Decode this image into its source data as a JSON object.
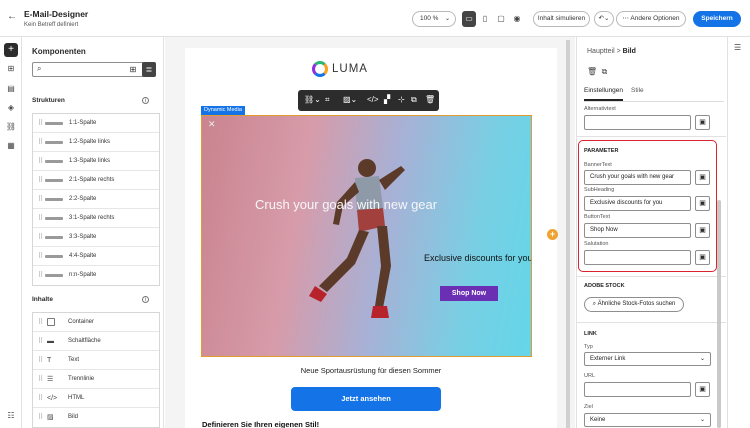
{
  "header": {
    "back_icon": "arrow-left-icon",
    "title": "E-Mail-Designer",
    "subtitle": "Kein Betreff definiert",
    "zoom": "100 %",
    "preview_label": "Inhalt simulieren",
    "more_label": "Andere Optionen",
    "save_label": "Speichern"
  },
  "components": {
    "title": "Komponenten",
    "search_placeholder": "",
    "structures_title": "Strukturen",
    "structures": [
      "1:1-Spalte",
      "1:2-Spalte links",
      "1:3-Spalte links",
      "2:1-Spalte rechts",
      "2:2-Spalte",
      "3:1-Spalte rechts",
      "3:3-Spalte",
      "4:4-Spalte",
      "n:n-Spalte"
    ],
    "content_title": "Inhalte",
    "contents": [
      {
        "label": "Container",
        "icon": "container-icon"
      },
      {
        "label": "Schaltfläche",
        "icon": "button-icon"
      },
      {
        "label": "Text",
        "icon": "text-icon"
      },
      {
        "label": "Trennlinie",
        "icon": "divider-icon"
      },
      {
        "label": "HTML",
        "icon": "code-icon"
      },
      {
        "label": "Bild",
        "icon": "image-icon"
      }
    ]
  },
  "email": {
    "logo_text": "LUMA",
    "dynamic_media_tag": "Dynamic Media",
    "banner_heading": "Crush your goals with new gear",
    "banner_subheading": "Exclusive discounts for you",
    "banner_cta": "Shop Now",
    "subline": "Neue Sportausrüstung für diesen Sommer",
    "button_label": "Jetzt ansehen",
    "footer_heading": "Definieren Sie Ihren eigenen Stil!"
  },
  "properties": {
    "crumb_parent": "Hauptteil",
    "crumb_sep": ">",
    "crumb_current": "Bild",
    "tab_settings": "Einstellungen",
    "tab_styles": "Stile",
    "alt_label": "Alternativtext",
    "alt_value": "",
    "params_title": "PARAMETER",
    "params": [
      {
        "label": "BannerText",
        "value": "Crush your goals with new gear"
      },
      {
        "label": "SubHeading",
        "value": "Exclusive discounts for you"
      },
      {
        "label": "ButtonText",
        "value": "Shop Now"
      },
      {
        "label": "Salutation",
        "value": ""
      }
    ],
    "stock_title": "ADOBE STOCK",
    "stock_button": "Ähnliche Stock-Fotos suchen",
    "link_title": "LINK",
    "type_label": "Typ",
    "type_value": "Externer Link",
    "url_label": "URL",
    "url_value": "",
    "target_label": "Ziel",
    "target_value": "Keine"
  }
}
